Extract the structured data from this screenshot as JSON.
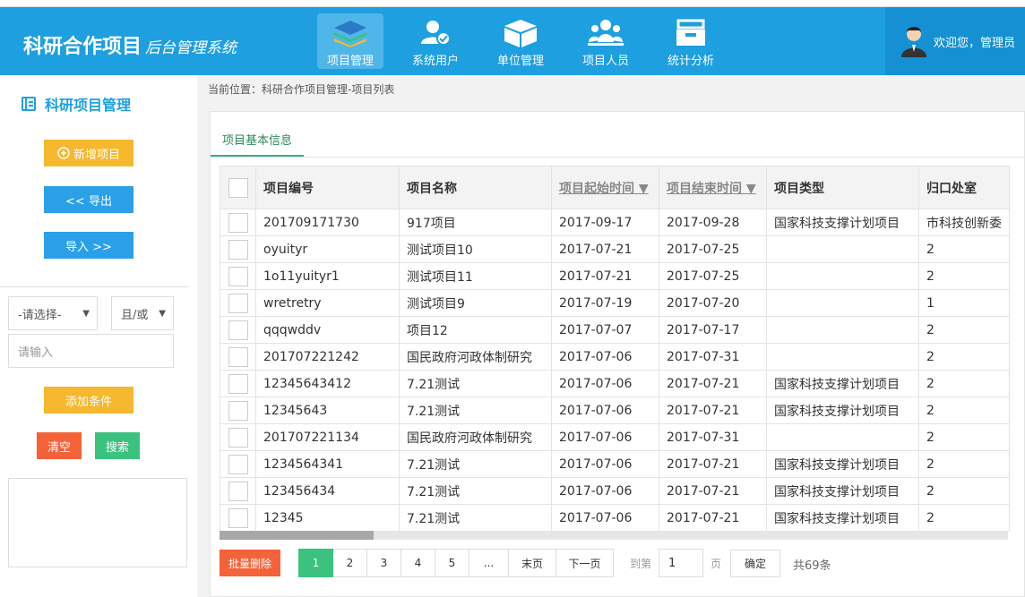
{
  "app": {
    "title": "科研合作项目",
    "subtitle": "后台管理系统",
    "welcome": "欢迎您，管理员"
  },
  "nav": [
    {
      "label": "项目管理",
      "icon": "layers-icon",
      "active": true
    },
    {
      "label": "系统用户",
      "icon": "user-check-icon",
      "active": false
    },
    {
      "label": "单位管理",
      "icon": "box-icon",
      "active": false
    },
    {
      "label": "项目人员",
      "icon": "people-icon",
      "active": false
    },
    {
      "label": "统计分析",
      "icon": "inbox-icon",
      "active": false
    }
  ],
  "sidebar": {
    "title": "科研项目管理",
    "add_project": "新增项目",
    "export": "<< 导出",
    "import": "导入 >>",
    "select_placeholder": "-请选择-",
    "logic_select": "且/或",
    "input_placeholder": "请输入",
    "add_condition": "添加条件",
    "clear": "清空",
    "search": "搜索"
  },
  "breadcrumb": "当前位置：科研合作项目管理-项目列表",
  "tab": "项目基本信息",
  "table": {
    "headers": [
      "项目编号",
      "项目名称",
      "项目起始时间 ▼",
      "项目结束时间 ▼",
      "项目类型",
      "归口处室"
    ],
    "rows": [
      [
        "201709171730",
        "917项目",
        "2017-09-17",
        "2017-09-28",
        "国家科技支撑计划项目",
        "市科技创新委"
      ],
      [
        "oyuityr",
        "测试项目10",
        "2017-07-21",
        "2017-07-25",
        "",
        "2"
      ],
      [
        "1o11yuityr1",
        "测试项目11",
        "2017-07-21",
        "2017-07-25",
        "",
        "2"
      ],
      [
        "wretretry",
        "测试项目9",
        "2017-07-19",
        "2017-07-20",
        "",
        "1"
      ],
      [
        "qqqwddv",
        "项目12",
        "2017-07-07",
        "2017-07-17",
        "",
        "2"
      ],
      [
        "201707221242",
        "国民政府河政体制研究",
        "2017-07-06",
        "2017-07-31",
        "",
        "2"
      ],
      [
        "12345643412",
        "7.21测试",
        "2017-07-06",
        "2017-07-21",
        "国家科技支撑计划项目",
        "2"
      ],
      [
        "12345643",
        "7.21测试",
        "2017-07-06",
        "2017-07-21",
        "国家科技支撑计划项目",
        "2"
      ],
      [
        "201707221134",
        "国民政府河政体制研究",
        "2017-07-06",
        "2017-07-31",
        "",
        "2"
      ],
      [
        "1234564341",
        "7.21测试",
        "2017-07-06",
        "2017-07-21",
        "国家科技支撑计划项目",
        "2"
      ],
      [
        "123456434",
        "7.21测试",
        "2017-07-06",
        "2017-07-21",
        "国家科技支撑计划项目",
        "2"
      ],
      [
        "12345",
        "7.21测试",
        "2017-07-06",
        "2017-07-21",
        "国家科技支撑计划项目",
        "2"
      ]
    ]
  },
  "pager": {
    "batch_delete": "批量删除",
    "pages": [
      "1",
      "2",
      "3",
      "4",
      "5",
      "..."
    ],
    "current": "1",
    "last": "末页",
    "next": "下一页",
    "goto": "到第",
    "goto_value": "1",
    "page_unit": "页",
    "confirm": "确定",
    "total": "共69条"
  },
  "colors": {
    "header": "#1e9fe0",
    "accent_green": "#3bc27e",
    "yellow": "#f5b82e",
    "orange": "#f4623a"
  }
}
